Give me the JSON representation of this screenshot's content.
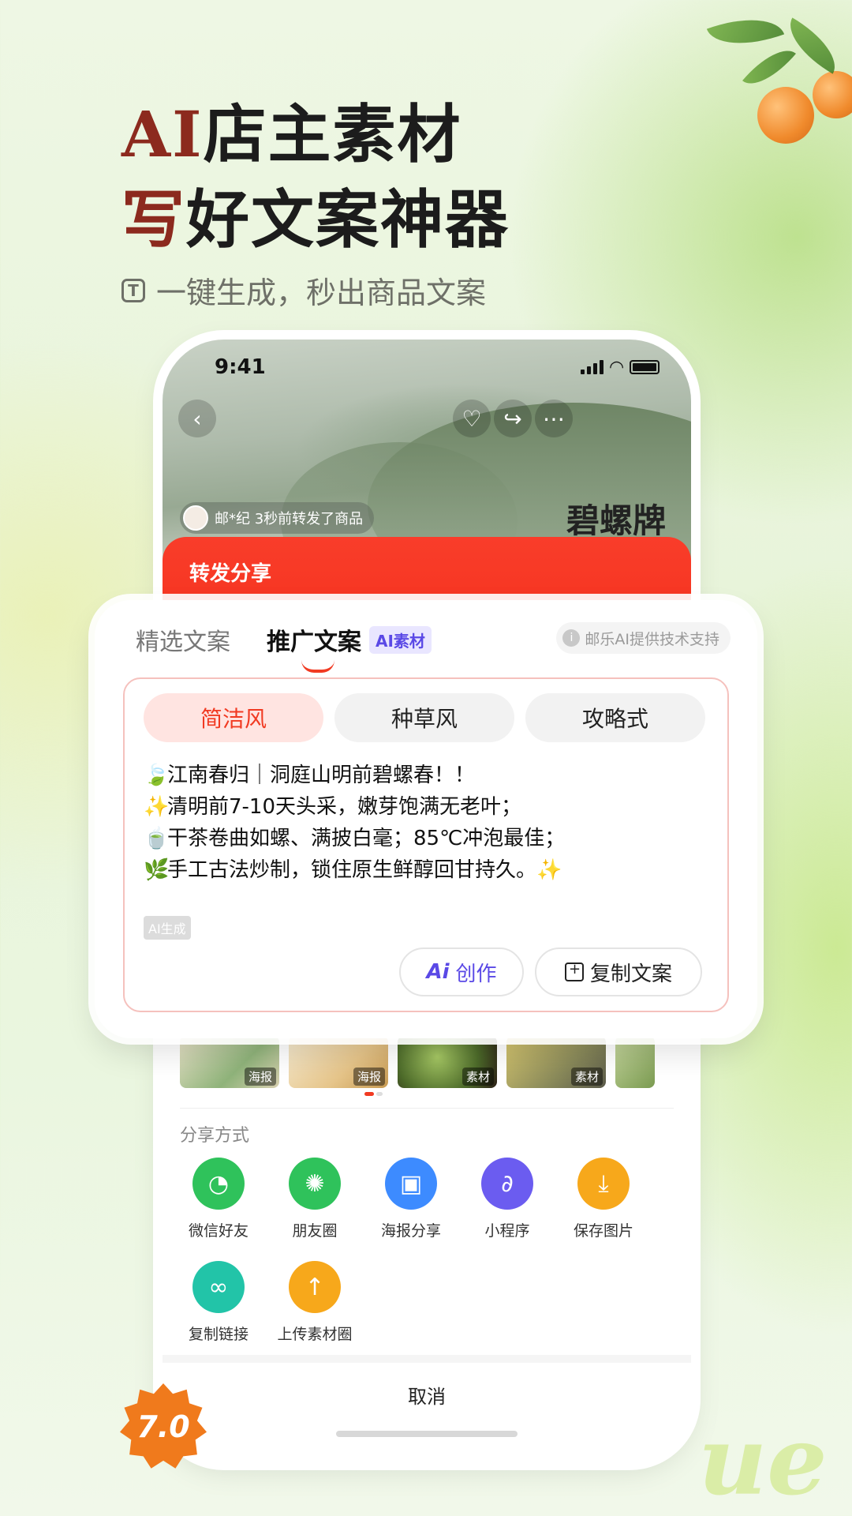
{
  "hero": {
    "title_ai": "AI",
    "title_line1_rest": "店主素材",
    "title_line2_first": "写",
    "title_line2_rest": "好文案神器",
    "subtitle_icon": "T",
    "subtitle": "一键生成，秒出商品文案"
  },
  "status_bar": {
    "time": "9:41"
  },
  "product": {
    "back_icon": "‹",
    "forward_notice": "邮*纪 3秒前转发了商品",
    "brand_text": "碧螺牌"
  },
  "share_sheet": {
    "title": "转发分享",
    "tabs": [
      {
        "label": "精选文案"
      },
      {
        "label": "推广文案"
      }
    ],
    "ai_badge": "AI素材",
    "powered_by": "邮乐AI提供技术支持",
    "styles": [
      {
        "label": "简洁风"
      },
      {
        "label": "种草风"
      },
      {
        "label": "攻略式"
      }
    ],
    "copy_lines": [
      {
        "emoji": "🍃",
        "text": "江南春归｜洞庭山明前碧螺春！！"
      },
      {
        "emoji": "✨",
        "text": "清明前7-10天头采，嫩芽饱满无老叶；"
      },
      {
        "emoji": "🍵",
        "text": "干茶卷曲如螺、满披白毫；85℃冲泡最佳；"
      },
      {
        "emoji": "🌿",
        "text": "手工古法炒制，锁住原生鲜醇回甘持久。✨"
      }
    ],
    "ai_generated_tag": "AI生成",
    "ai_create_label": "创作",
    "ai_create_mark": "Ai",
    "copy_button": "复制文案",
    "thumbs": [
      {
        "tag": "海报"
      },
      {
        "tag": "海报"
      },
      {
        "tag": "素材"
      },
      {
        "tag": "素材"
      },
      {
        "tag": ""
      }
    ],
    "share_methods_title": "分享方式",
    "share_methods": [
      {
        "label": "微信好友",
        "icon": "wechat-icon",
        "color": "#2fc25b"
      },
      {
        "label": "朋友圈",
        "icon": "moments-icon",
        "color": "#2fc25b"
      },
      {
        "label": "海报分享",
        "icon": "poster-icon",
        "color": "#3d8bff"
      },
      {
        "label": "小程序",
        "icon": "mini-program-icon",
        "color": "#6b5cf0"
      },
      {
        "label": "保存图片",
        "icon": "download-icon",
        "color": "#f7a81b"
      },
      {
        "label": "复制链接",
        "icon": "link-icon",
        "color": "#22c4a8"
      },
      {
        "label": "上传素材圈",
        "icon": "upload-icon",
        "color": "#f7a81b"
      }
    ],
    "cancel": "取消"
  },
  "version_badge": "7.0",
  "watermark": "ue",
  "colors": {
    "accent": "#f13a22",
    "ai_purple": "#5a49e6",
    "title_red": "#8c2a1e"
  }
}
